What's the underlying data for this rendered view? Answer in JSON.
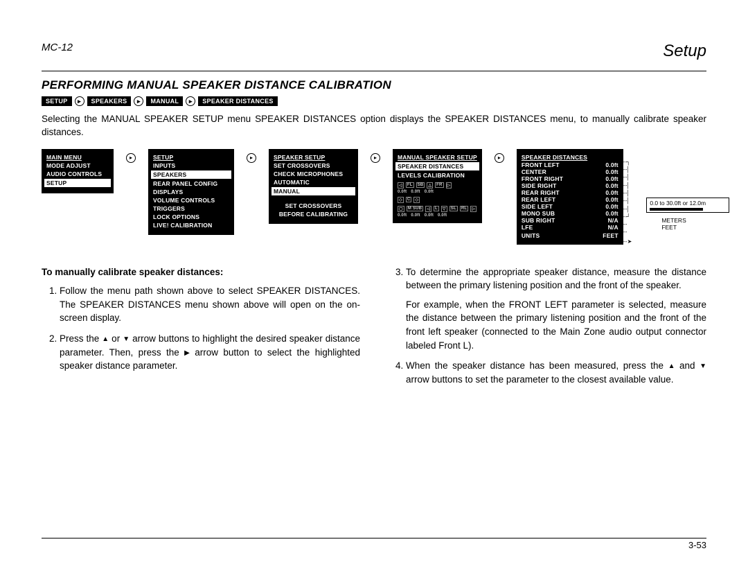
{
  "header": {
    "model": "MC-12",
    "section": "Setup"
  },
  "title": "PERFORMING MANUAL SPEAKER DISTANCE CALIBRATION",
  "breadcrumb": [
    "SETUP",
    "SPEAKERS",
    "MANUAL",
    "SPEAKER DISTANCES"
  ],
  "intro": "Selecting the MANUAL SPEAKER SETUP menu SPEAKER DISTANCES option displays the SPEAKER DISTANCES menu, to manually calibrate speaker distances.",
  "menus": {
    "main": {
      "title": "MAIN MENU",
      "items": [
        "MODE ADJUST",
        "AUDIO CONTROLS",
        "SETUP"
      ],
      "highlight": "SETUP"
    },
    "setup": {
      "title": "SETUP",
      "items": [
        "INPUTS",
        "SPEAKERS",
        "REAR PANEL CONFIG",
        "DISPLAYS",
        "VOLUME CONTROLS",
        "TRIGGERS",
        "LOCK OPTIONS",
        "LIVE! CALIBRATION"
      ],
      "highlight": "SPEAKERS"
    },
    "speaker_setup": {
      "title": "SPEAKER SETUP",
      "items": [
        "SET CROSSOVERS",
        "CHECK MICROPHONES",
        "AUTOMATIC",
        "MANUAL"
      ],
      "highlight": "MANUAL",
      "footer": [
        "SET CROSSOVERS",
        "BEFORE CALIBRATING"
      ]
    },
    "manual_setup": {
      "title": "MANUAL SPEAKER SETUP",
      "items": [
        "SPEAKER DISTANCES",
        "LEVELS CALIBRATION"
      ],
      "highlight": "SPEAKER DISTANCES",
      "diagram_labels_top": [
        "FL",
        "SB",
        "FR"
      ],
      "diagram_dist_top": [
        "0.0ft",
        "0.0ft",
        "0.0ft"
      ],
      "diagram_labels_mid": [
        "C"
      ],
      "diagram_labels_bot": [
        "M SUB",
        "L",
        "SL",
        "RL"
      ],
      "diagram_dist_bot": [
        "0.0ft",
        "0.0ft",
        "0.0ft",
        "0.0ft"
      ]
    },
    "distances": {
      "title": "SPEAKER DISTANCES",
      "rows": [
        {
          "label": "FRONT LEFT",
          "val": "0.0ft"
        },
        {
          "label": "CENTER",
          "val": "0.0ft"
        },
        {
          "label": "FRONT RIGHT",
          "val": "0.0ft"
        },
        {
          "label": "SIDE RIGHT",
          "val": "0.0ft"
        },
        {
          "label": "REAR RIGHT",
          "val": "0.0ft"
        },
        {
          "label": "REAR LEFT",
          "val": "0.0ft"
        },
        {
          "label": "SIDE LEFT",
          "val": "0.0ft"
        },
        {
          "label": "MONO SUB",
          "val": "0.0ft"
        },
        {
          "label": "SUB RIGHT",
          "val": "N/A"
        },
        {
          "label": "LFE",
          "val": "N/A"
        },
        {
          "label": "UNITS",
          "val": "FEET"
        }
      ]
    }
  },
  "range_note": "0.0 to 30.0ft or 12.0m",
  "units_options": [
    "METERS",
    "FEET"
  ],
  "left_col": {
    "lead": "To manually calibrate speaker distances:",
    "step1": "Follow the menu path shown above to select SPEAKER DISTANCES. The SPEAKER DISTANCES menu shown above will open on the on-screen display.",
    "step2a": "Press the ",
    "step2b": " or ",
    "step2c": " arrow buttons to highlight the desired speaker distance parameter. Then, press the ",
    "step2d": " arrow button to select the highlighted speaker distance parameter."
  },
  "right_col": {
    "step3": "To determine the appropriate speaker distance, measure the distance between the primary listening position and the front of the speaker.",
    "step3b": "For example, when the FRONT LEFT parameter is selected, measure the distance between the primary listening position and the front of the front left speaker (connected to the Main Zone audio output connector labeled Front L).",
    "step4a": "When the speaker distance has been measured, press the ",
    "step4b": " and ",
    "step4c": " arrow buttons to set the parameter to the closest available value."
  },
  "page_no": "3-53"
}
